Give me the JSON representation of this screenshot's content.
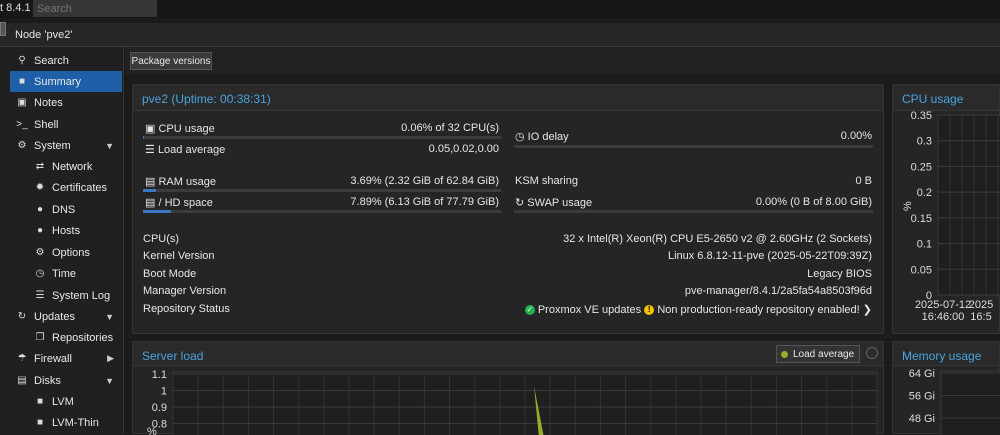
{
  "header": {
    "version": "t 8.4.1",
    "search_placeholder": "Search"
  },
  "node": {
    "title": "Node 'pve2'"
  },
  "nav": {
    "items": [
      {
        "label": "Search",
        "icon": "search-icon"
      },
      {
        "label": "Summary",
        "icon": "book-icon"
      },
      {
        "label": "Notes",
        "icon": "notes-icon"
      },
      {
        "label": "Shell",
        "icon": "terminal-icon"
      },
      {
        "label": "System",
        "icon": "gears-icon"
      },
      {
        "label": "Network",
        "icon": "exchange-icon"
      },
      {
        "label": "Certificates",
        "icon": "certificate-icon"
      },
      {
        "label": "DNS",
        "icon": "globe-icon"
      },
      {
        "label": "Hosts",
        "icon": "globe-icon"
      },
      {
        "label": "Options",
        "icon": "gear-icon"
      },
      {
        "label": "Time",
        "icon": "clock-icon"
      },
      {
        "label": "System Log",
        "icon": "list-icon"
      },
      {
        "label": "Updates",
        "icon": "refresh-icon"
      },
      {
        "label": "Repositories",
        "icon": "files-icon"
      },
      {
        "label": "Firewall",
        "icon": "shield-icon"
      },
      {
        "label": "Disks",
        "icon": "hdd-icon"
      },
      {
        "label": "LVM",
        "icon": "square-icon"
      },
      {
        "label": "LVM-Thin",
        "icon": "square-icon"
      }
    ]
  },
  "toolbar": {
    "package_versions": "Package versions"
  },
  "summary": {
    "title": "pve2 (Uptime: 00:38:31)",
    "cpu_label": "CPU usage",
    "cpu_value": "0.06% of 32 CPU(s)",
    "cpu_fraction": 0.0006,
    "io_label": "IO delay",
    "io_value": "0.00%",
    "load_label": "Load average",
    "load_value": "0.05,0.02,0.00",
    "ram_label": "RAM usage",
    "ram_value": "3.69% (2.32 GiB of 62.84 GiB)",
    "ram_fraction": 0.0369,
    "ksm_label": "KSM sharing",
    "ksm_value": "0 B",
    "hd_label": "/ HD space",
    "hd_value": "7.89% (6.13 GiB of 77.79 GiB)",
    "hd_fraction": 0.0789,
    "swap_label": "SWAP usage",
    "swap_value": "0.00% (0 B of 8.00 GiB)",
    "cpus_label": "CPU(s)",
    "cpus_value": "32 x Intel(R) Xeon(R) CPU E5-2650 v2 @ 2.60GHz (2 Sockets)",
    "kernel_label": "Kernel Version",
    "kernel_value": "Linux 6.8.12-11-pve (2025-05-22T09:39Z)",
    "boot_label": "Boot Mode",
    "boot_value": "Legacy BIOS",
    "manager_label": "Manager Version",
    "manager_value": "pve-manager/8.4.1/2a5fa54a8503f96d",
    "repo_label": "Repository Status",
    "repo_ok": "Proxmox VE updates",
    "repo_warn": "Non production-ready repository enabled!"
  },
  "load_panel": {
    "title": "Server load",
    "legend": "Load average",
    "series_color": "#9aab2a"
  },
  "cpu_panel": {
    "title": "CPU usage"
  },
  "mem_panel": {
    "title": "Memory usage"
  },
  "chart_data": [
    {
      "type": "area",
      "title": "Server load",
      "ylabel": "%",
      "y_ticks": [
        "1.1",
        "1",
        "0.9",
        "0.8"
      ],
      "series": [
        {
          "name": "Load average",
          "color": "#9aab2a",
          "spike_at_fraction": 0.5
        }
      ]
    },
    {
      "type": "line",
      "title": "CPU usage",
      "ylabel": "%",
      "y_ticks": [
        "0.35",
        "0.3",
        "0.25",
        "0.2",
        "0.15",
        "0.1",
        "0.05",
        "0"
      ],
      "x_ticks": [
        {
          "date": "2025-07-12",
          "time": "16:46:00"
        },
        {
          "date": "2025",
          "time": "16:5"
        }
      ],
      "ylim": [
        0,
        0.35
      ]
    },
    {
      "type": "area",
      "title": "Memory usage",
      "y_ticks": [
        "64 Gi",
        "56 Gi",
        "48 Gi"
      ]
    }
  ]
}
